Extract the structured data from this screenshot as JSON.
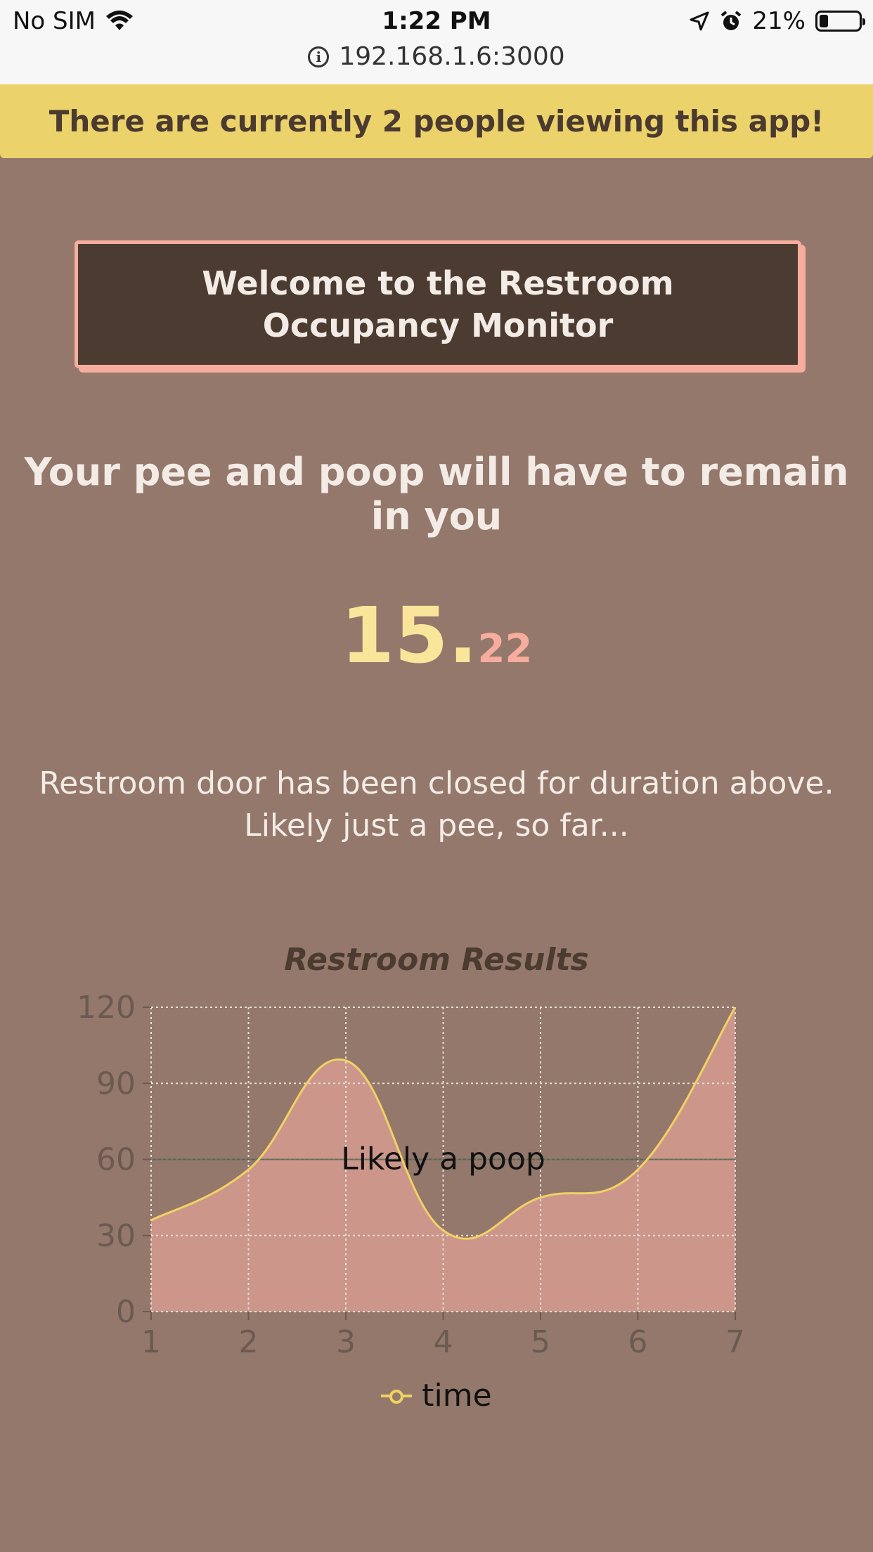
{
  "status_bar": {
    "carrier": "No SIM",
    "time": "1:22 PM",
    "battery": "21%"
  },
  "address_bar": {
    "url": "192.168.1.6:3000"
  },
  "banner": {
    "text": "There are currently 2 people viewing this app!"
  },
  "welcome": {
    "text": "Welcome to the Restroom Occupancy Monitor"
  },
  "headline": "Your pee and poop will have to remain in you",
  "timer": {
    "whole": "15.",
    "fraction": "22"
  },
  "status_text": {
    "line1": "Restroom door has been closed for duration above.",
    "line2": "Likely just a pee, so far..."
  },
  "colors": {
    "background": "#94786b",
    "banner": "#ecd26a",
    "accent": "#f6ad9e",
    "line": "#f0d264",
    "fill": "#cc968a"
  },
  "chart_data": {
    "type": "area",
    "title": "Restroom Results",
    "x": [
      1,
      2,
      3,
      4,
      5,
      6,
      7
    ],
    "series": [
      {
        "name": "time",
        "values": [
          36,
          56,
          99,
          32,
          45,
          56,
          120
        ]
      }
    ],
    "xlim": [
      1,
      7
    ],
    "ylim": [
      0,
      120
    ],
    "yticks": [
      0,
      30,
      60,
      90,
      120
    ],
    "grid": true,
    "legend": "bottom",
    "annotation": {
      "value": 60,
      "label": "Likely a poop"
    }
  }
}
